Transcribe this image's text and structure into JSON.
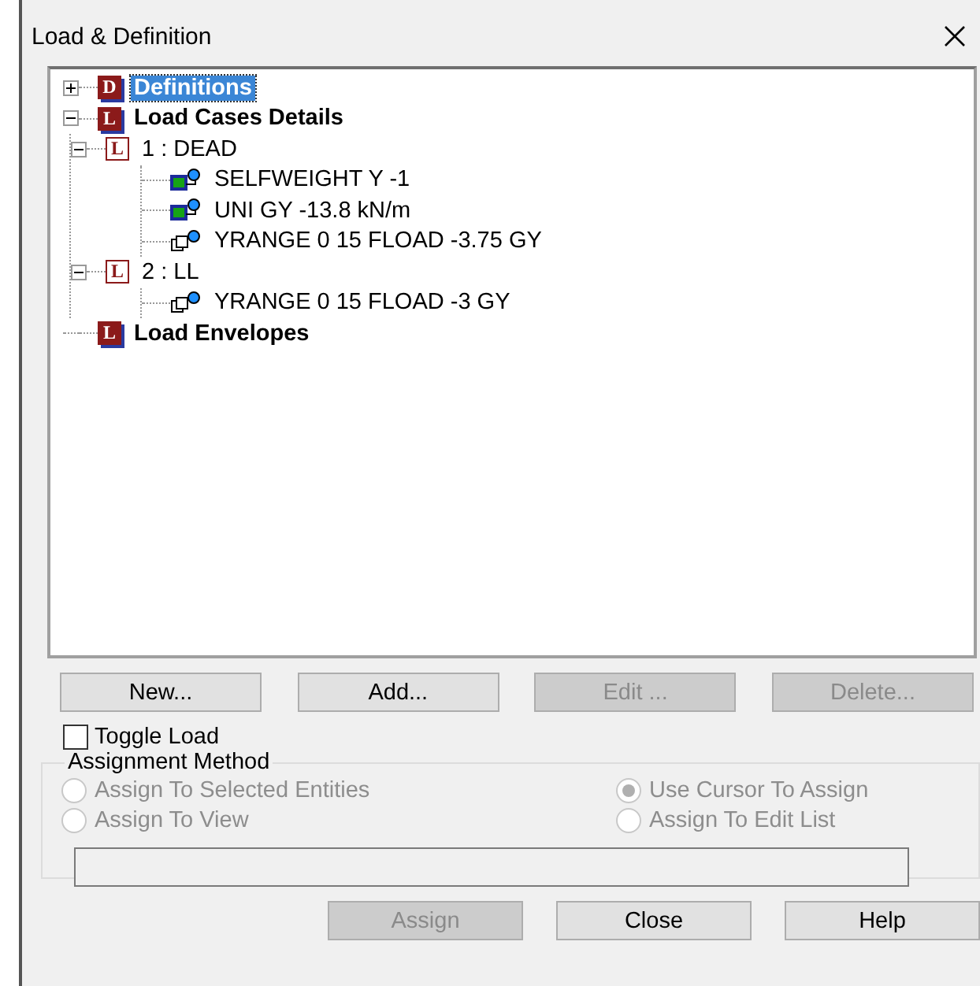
{
  "window": {
    "title": "Load & Definition"
  },
  "tree": [
    {
      "label": "Definitions",
      "badge": "D",
      "kind": "group",
      "expanded": false,
      "selected": true
    },
    {
      "label": "Load Cases Details",
      "badge": "L",
      "kind": "group",
      "expanded": true,
      "selected": false,
      "children": [
        {
          "label": "1 : DEAD",
          "badge": "L",
          "kind": "case",
          "expanded": true,
          "selected": false,
          "children": [
            {
              "label": "SELFWEIGHT Y -1",
              "kind": "member-load",
              "selected": false
            },
            {
              "label": "UNI GY -13.8 kN/m",
              "kind": "member-load",
              "selected": false
            },
            {
              "label": "YRANGE 0 15 FLOAD -3.75 GY",
              "kind": "floor-load",
              "selected": false
            }
          ]
        },
        {
          "label": "2 : LL",
          "badge": "L",
          "kind": "case",
          "expanded": true,
          "selected": false,
          "children": [
            {
              "label": "YRANGE 0 15 FLOAD -3 GY",
              "kind": "floor-load",
              "selected": false
            }
          ]
        }
      ]
    },
    {
      "label": "Load Envelopes",
      "badge": "L",
      "kind": "group",
      "selected": false
    }
  ],
  "tree_buttons": [
    {
      "label": "New...",
      "disabled": false
    },
    {
      "label": "Add...",
      "disabled": false
    },
    {
      "label": "Edit ...",
      "disabled": true
    },
    {
      "label": "Delete...",
      "disabled": true
    }
  ],
  "toggle_load": {
    "label": "Toggle Load",
    "checked": false
  },
  "assignment_method": {
    "title": "Assignment Method",
    "options": [
      {
        "label": "Assign To Selected Entities",
        "selected": false,
        "disabled": true
      },
      {
        "label": "Use Cursor To Assign",
        "selected": true,
        "disabled": true
      },
      {
        "label": "Assign To View",
        "selected": false,
        "disabled": true
      },
      {
        "label": "Assign To Edit List",
        "selected": false,
        "disabled": true
      }
    ]
  },
  "footer_buttons": [
    {
      "label": "Assign",
      "disabled": true
    },
    {
      "label": "Close",
      "disabled": false
    },
    {
      "label": "Help",
      "disabled": false
    }
  ]
}
